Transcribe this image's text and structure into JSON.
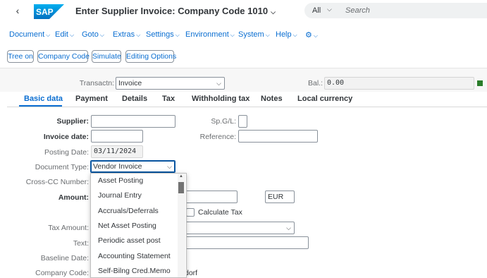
{
  "shell": {
    "back_icon": "chevron-left-icon",
    "logo_text": "SAP",
    "title": "Enter Supplier Invoice: Company Code 1010",
    "search_scope": "All",
    "search_placeholder": "Search"
  },
  "menu": [
    "Document",
    "Edit",
    "Goto",
    "Extras",
    "Settings",
    "Environment",
    "System",
    "Help"
  ],
  "toolbar": [
    "Tree on",
    "Company Code",
    "Simulate",
    "Editing Options"
  ],
  "header": {
    "transaction_label": "Transactn:",
    "transaction_value": "Invoice",
    "balance_label": "Bal.:",
    "balance_value": "0.00"
  },
  "tabs": [
    "Basic data",
    "Payment",
    "Details",
    "Tax",
    "Withholding tax",
    "Notes",
    "Local currency"
  ],
  "form": {
    "supplier_label": "Supplier:",
    "spgl_label": "Sp.G/L:",
    "invoice_date_label": "Invoice date:",
    "reference_label": "Reference:",
    "posting_date_label": "Posting Date:",
    "posting_date_value": "03/11/2024",
    "doc_type_label": "Document Type:",
    "doc_type_value": "Vendor Invoice",
    "cross_cc_label": "Cross-CC Number:",
    "amount_label": "Amount:",
    "currency_value": "EUR",
    "calc_tax_label": "Calculate Tax",
    "tax_amount_label": "Tax Amount:",
    "text_label": "Text:",
    "baseline_label": "Baseline Date:",
    "company_code_label": "Company Code:",
    "company_code_partial": "dorf"
  },
  "dropdown": [
    "Asset Posting",
    "Journal Entry",
    "Accruals/Deferrals",
    "Net Asset Posting",
    "Periodic asset post",
    "Accounting Statement",
    "Self-Bilng Cred.Memo"
  ],
  "colors": {
    "accent": "#0a6ed1",
    "sap_blue": "#0070c0",
    "status_green": "#2b7d2b"
  }
}
